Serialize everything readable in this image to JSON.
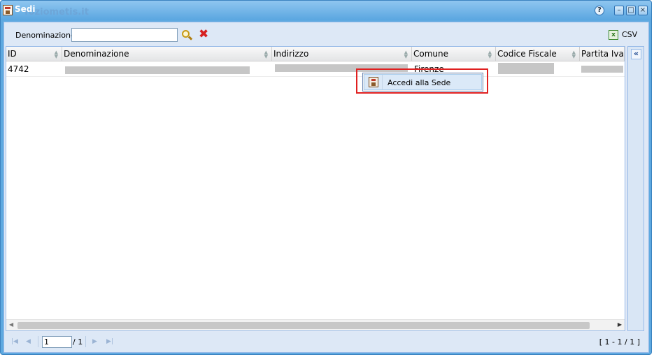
{
  "window": {
    "title": "Sedi",
    "watermark": "foziometis.it",
    "help_symbol": "?",
    "minimize_symbol": "–",
    "maximize_symbol": "□",
    "close_symbol": "×"
  },
  "toolbar": {
    "filter_label": "Denominazione",
    "filter_value": "",
    "clear_symbol": "✖",
    "csv_label": "CSV"
  },
  "grid": {
    "columns": [
      "ID",
      "Denominazione",
      "Indirizzo",
      "Comune",
      "Codice Fiscale",
      "Partita Iva"
    ],
    "rows": [
      {
        "id": "4742",
        "comune": "Firenze"
      }
    ]
  },
  "context_menu": {
    "items": [
      {
        "label": "Accedi alla Sede",
        "icon": "building-icon"
      }
    ]
  },
  "pager": {
    "current_page": "1",
    "of_pages": "/ 1",
    "info": "[ 1 - 1 / 1 ]"
  },
  "colors": {
    "window_blue": "#5ea9e0",
    "panel_bg": "#dfe8f6",
    "highlight_red": "#e02020"
  }
}
